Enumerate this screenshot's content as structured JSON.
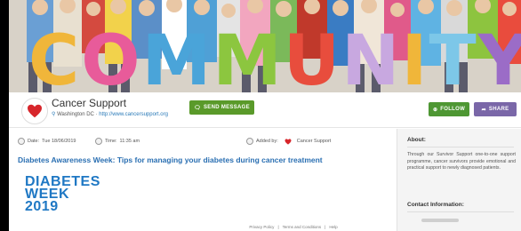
{
  "banner": {
    "word": "COMMUNITY",
    "letter_colors": [
      "#f0b63a",
      "#e85b9a",
      "#4aa4d9",
      "#8cc63f",
      "#e84d3d",
      "#c8a8e0",
      "#f0b63a",
      "#7dc7e8",
      "#9b6cc7"
    ]
  },
  "profile": {
    "name": "Cancer Support",
    "location": "Washington DC",
    "separator": "·",
    "url": "http://www.cancersupport.org",
    "send_message_label": "SEND MESSAGE",
    "follow_label": "FOLLOW",
    "share_label": "SHARE"
  },
  "post": {
    "date_label": "Date:",
    "date": "Tue 18/06/2019",
    "time_label": "Time:",
    "time": "11:35 am",
    "added_by_label": "Added by:",
    "added_by": "Cancer Support",
    "title": "Diabetes Awareness Week: Tips for managing your diabetes during cancer treatment",
    "image_lines": [
      "DIABETES",
      "WEEK",
      "2019"
    ]
  },
  "sidebar": {
    "about_heading": "About:",
    "about_text": "Through our Survivor Support one-to-one support programme, cancer survivors provide emotional and practical support to newly diagnosed patients.",
    "contact_heading": "Contact Information:"
  },
  "footer": {
    "links": [
      "Privacy Policy",
      "Terms and Conditions",
      "Help"
    ],
    "separator": "|"
  },
  "colors": {
    "heart": "#d7262b",
    "link_blue": "#2a6fb2",
    "green_button": "#5a9a2a",
    "purple_button": "#7a67a8"
  }
}
